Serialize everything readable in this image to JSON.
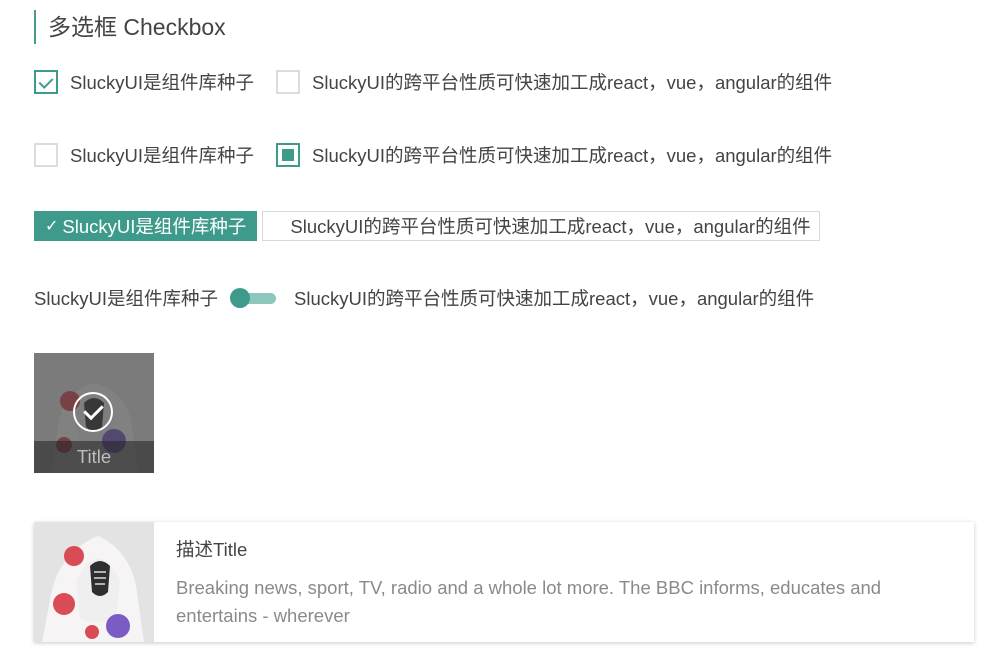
{
  "header": {
    "title": "多选框 Checkbox"
  },
  "row1": [
    {
      "label": "SluckyUI是组件库种子",
      "state": "checked"
    },
    {
      "label": "SluckyUI的跨平台性质可快速加工成react，vue，angular的组件",
      "state": "unchecked"
    }
  ],
  "row2": [
    {
      "label": "SluckyUI是组件库种子",
      "state": "unchecked"
    },
    {
      "label": "SluckyUI的跨平台性质可快速加工成react，vue，angular的组件",
      "state": "indeterminate"
    }
  ],
  "row3": [
    {
      "label": "SluckyUI是组件库种子",
      "state": "checked",
      "check_glyph": "✓"
    },
    {
      "label": "SluckyUI的跨平台性质可快速加工成react，vue，angular的组件",
      "state": "unchecked"
    }
  ],
  "row4": {
    "left_label": "SluckyUI是组件库种子",
    "right_label": "SluckyUI的跨平台性质可快速加工成react，vue，angular的组件",
    "toggle_on": false
  },
  "image_tile": {
    "caption": "Title",
    "checked": true
  },
  "card": {
    "title": "描述Title",
    "description": "Breaking news, sport, TV, radio and a whole lot more. The BBC informs, educates and entertains - wherever"
  },
  "colors": {
    "accent": "#3e9b8c",
    "accent_light": "#8cc7bd",
    "border": "#dcdcdc",
    "text": "#444444",
    "muted": "#8a8a8a"
  }
}
